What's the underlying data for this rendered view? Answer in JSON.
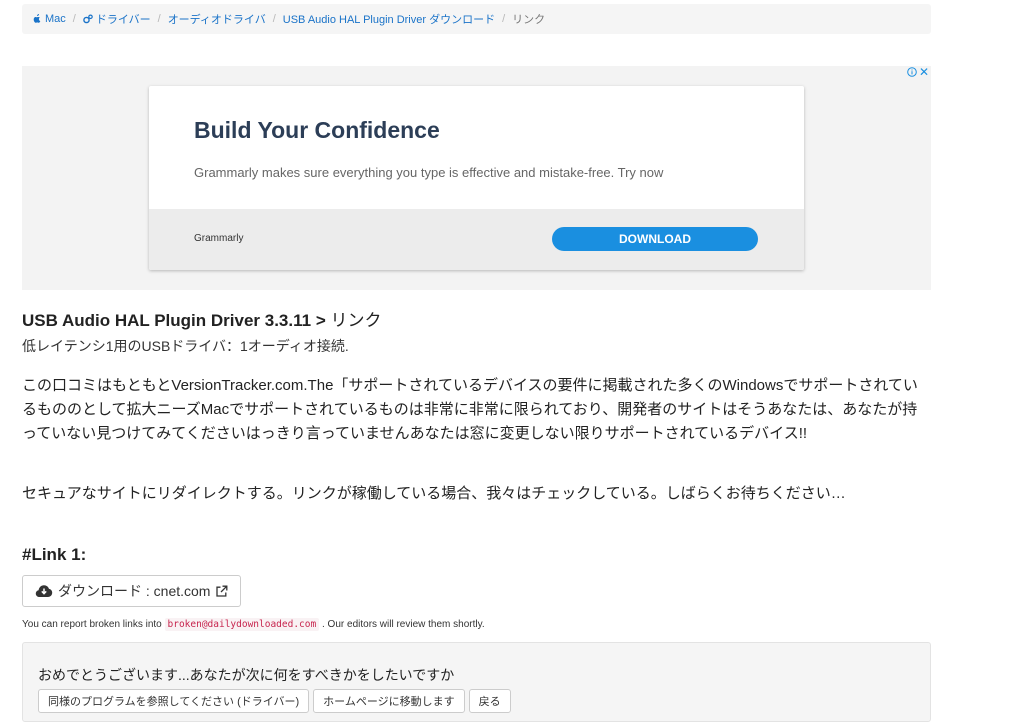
{
  "breadcrumb": {
    "items": [
      {
        "label": "Mac",
        "icon": "apple-icon"
      },
      {
        "label": "ドライバー",
        "icon": "gears-icon"
      },
      {
        "label": "オーディオドライバ"
      },
      {
        "label": "USB Audio HAL Plugin Driver ダウンロード"
      }
    ],
    "current": "リンク",
    "separator": "/"
  },
  "ad": {
    "close_glyph": "✕",
    "headline": "Build Your Confidence",
    "subtext": "Grammarly makes sure everything you type is effective and mistake-free. Try now",
    "brand": "Grammarly",
    "button_label": "DOWNLOAD",
    "button_color": "#1a8fe0"
  },
  "page": {
    "title": "USB Audio HAL Plugin Driver 3.3.11",
    "title_arrow": ">",
    "title_suffix": "リンク",
    "subtitle": "低レイテンシ1用のUSBドライバ：1オーディオ接続.",
    "paragraph1": "この口コミはもともとVersionTracker.com.The「サポートされているデバイスの要件に掲載された多くのWindowsでサポートされているもののとして拡大ニーズMacでサポートされているものは非常に非常に限られており、開発者のサイトはそうあなたは、あなたが持っていない見つけてみてくださいはっきり言っていませんあなたは窓に変更しない限りサポートされているデバイス!!",
    "paragraph2": "セキュアなサイトにリダイレクトする。リンクが稼働している場合、我々はチェックしている。しばらくお待ちください…"
  },
  "link": {
    "heading": "#Link 1:",
    "button_label": "ダウンロード : cnet.com",
    "icon": "cloud-download-icon",
    "external_icon": "external-link-icon"
  },
  "report": {
    "prefix": "You can report broken links into",
    "email": "broken@dailydownloaded.com",
    "suffix": ". Our editors will review them shortly."
  },
  "next": {
    "title": "おめでとうございます...あなたが次に何をすべきかをしたいですか",
    "buttons": [
      "同様のプログラムを参照してください (ドライバー)",
      "ホームページに移動します",
      "戻る"
    ]
  },
  "colors": {
    "link": "#1a73c8",
    "accent": "#1a8fe0",
    "code": "#c7254e"
  }
}
